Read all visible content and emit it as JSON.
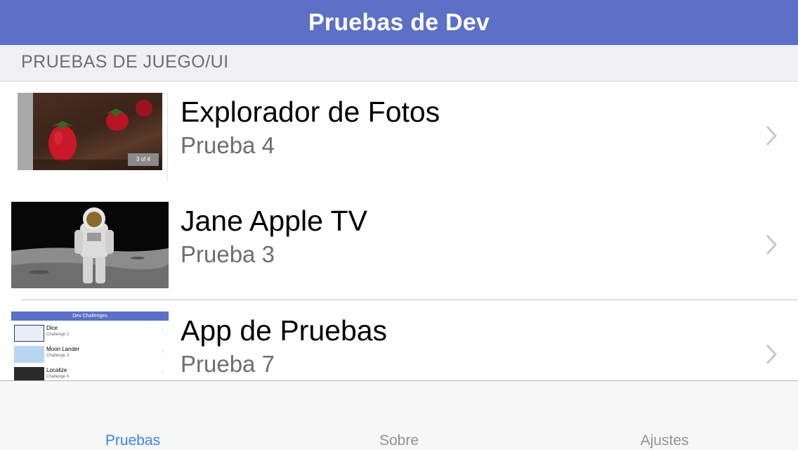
{
  "navbar": {
    "title": "Pruebas de Dev"
  },
  "section": {
    "header": "PRUEBAS DE JUEGO/UI"
  },
  "rows": [
    {
      "title": "Explorador de Fotos",
      "subtitle": "Prueba 4",
      "thumb_icon": "strawberry-photo",
      "badge": "3 of 4"
    },
    {
      "title": "Jane Apple TV",
      "subtitle": "Prueba 3",
      "thumb_icon": "astronaut-photo"
    },
    {
      "title": "App de Pruebas",
      "subtitle": "Prueba 7",
      "thumb_icon": "app-screenshot",
      "mini": {
        "title": "Dev Challenges",
        "items": [
          {
            "title": "Dice",
            "subtitle": "Challenge 2"
          },
          {
            "title": "Moon Lander",
            "subtitle": "Challenge 3"
          },
          {
            "title": "Localize",
            "subtitle": "Challenge 6"
          }
        ]
      }
    }
  ],
  "tabs": [
    {
      "label": "Pruebas",
      "active": true
    },
    {
      "label": "Sobre",
      "active": false
    },
    {
      "label": "Ajustes",
      "active": false
    }
  ],
  "colors": {
    "accent": "#5b70c6",
    "tab_active": "#3a82f7",
    "tab_inactive": "#929292"
  }
}
